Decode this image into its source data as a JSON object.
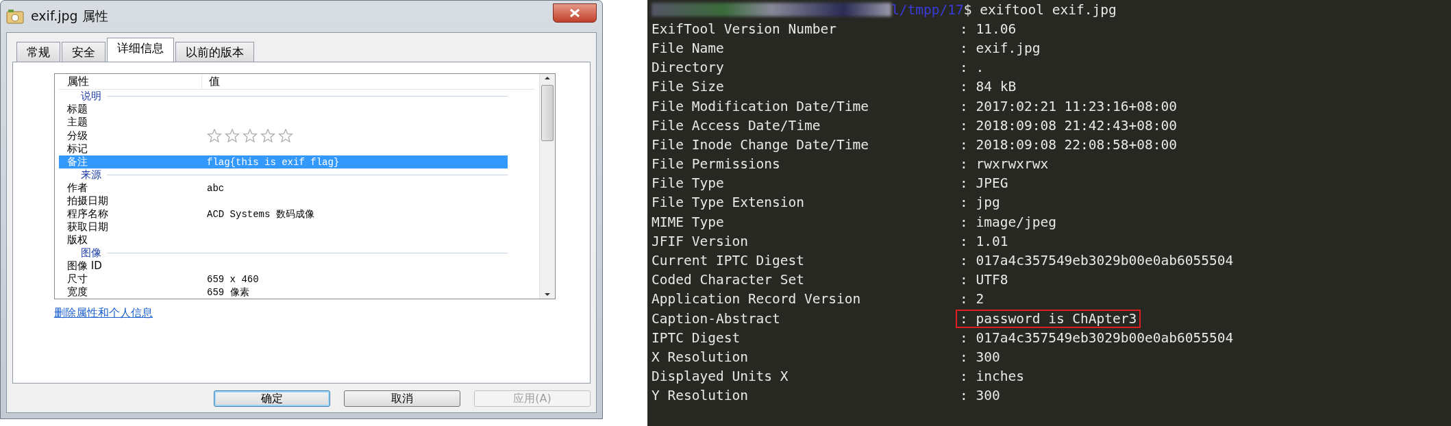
{
  "dialog": {
    "title": "exif.jpg 属性",
    "tabs": [
      {
        "label": "常规",
        "selected": false
      },
      {
        "label": "安全",
        "selected": false
      },
      {
        "label": "详细信息",
        "selected": true
      },
      {
        "label": "以前的版本",
        "selected": false
      }
    ],
    "columns": [
      "属性",
      "值"
    ],
    "groups": [
      {
        "title": "说明",
        "rows": [
          {
            "kind": "text",
            "name": "标题",
            "selected": false
          },
          {
            "kind": "text",
            "name": "主题",
            "selected": false
          },
          {
            "kind": "rating",
            "name": "分级",
            "stars": 0,
            "selected": false
          },
          {
            "kind": "text",
            "name": "标记",
            "selected": false
          },
          {
            "kind": "text",
            "name": "备注",
            "value": "flag{this is exif flag}",
            "selected": true
          }
        ]
      },
      {
        "title": "来源",
        "rows": [
          {
            "kind": "text",
            "name": "作者",
            "value": "abc",
            "selected": false
          },
          {
            "kind": "text",
            "name": "拍摄日期",
            "selected": false
          },
          {
            "kind": "text",
            "name": "程序名称",
            "value": "ACD Systems 数码成像",
            "selected": false
          },
          {
            "kind": "text",
            "name": "获取日期",
            "selected": false
          },
          {
            "kind": "text",
            "name": "版权",
            "selected": false
          }
        ]
      },
      {
        "title": "图像",
        "rows": [
          {
            "kind": "text",
            "name": "图像 ID",
            "selected": false
          },
          {
            "kind": "text",
            "name": "尺寸",
            "value": "659 x 460",
            "selected": false
          },
          {
            "kind": "text",
            "name": "宽度",
            "value": "659 像素",
            "selected": false
          }
        ]
      }
    ],
    "link": "删除属性和个人信息",
    "buttons": [
      {
        "label": "确定",
        "default": true,
        "disabled": false
      },
      {
        "label": "取消",
        "default": false,
        "disabled": false
      },
      {
        "label": "应用(A)",
        "default": false,
        "disabled": true
      }
    ]
  },
  "terminal": {
    "prompt_path": "l/tmpp/17",
    "command": "$ exiftool exif.jpg",
    "lines": [
      {
        "key": "ExifTool Version Number",
        "value": ": 11.06",
        "highlighted": false
      },
      {
        "key": "File Name",
        "value": ": exif.jpg",
        "highlighted": false
      },
      {
        "key": "Directory",
        "value": ": .",
        "highlighted": false
      },
      {
        "key": "File Size",
        "value": ": 84 kB",
        "highlighted": false
      },
      {
        "key": "File Modification Date/Time",
        "value": ": 2017:02:21 11:23:16+08:00",
        "highlighted": false
      },
      {
        "key": "File Access Date/Time",
        "value": ": 2018:09:08 21:42:43+08:00",
        "highlighted": false
      },
      {
        "key": "File Inode Change Date/Time",
        "value": ": 2018:09:08 22:08:58+08:00",
        "highlighted": false
      },
      {
        "key": "File Permissions",
        "value": ": rwxrwxrwx",
        "highlighted": false
      },
      {
        "key": "File Type",
        "value": ": JPEG",
        "highlighted": false
      },
      {
        "key": "File Type Extension",
        "value": ": jpg",
        "highlighted": false
      },
      {
        "key": "MIME Type",
        "value": ": image/jpeg",
        "highlighted": false
      },
      {
        "key": "JFIF Version",
        "value": ": 1.01",
        "highlighted": false
      },
      {
        "key": "Current IPTC Digest",
        "value": ": 017a4c357549eb3029b00e0ab6055504",
        "highlighted": false
      },
      {
        "key": "Coded Character Set",
        "value": ": UTF8",
        "highlighted": false
      },
      {
        "key": "Application Record Version",
        "value": ": 2",
        "highlighted": false
      },
      {
        "key": "Caption-Abstract",
        "value": ": password is ChApter3",
        "highlighted": true
      },
      {
        "key": "IPTC Digest",
        "value": ": 017a4c357549eb3029b00e0ab6055504",
        "highlighted": false
      },
      {
        "key": "X Resolution",
        "value": ": 300",
        "highlighted": false
      },
      {
        "key": "Displayed Units X",
        "value": ": inches",
        "highlighted": false
      },
      {
        "key": "Y Resolution",
        "value": ": 300",
        "highlighted": false
      }
    ]
  }
}
